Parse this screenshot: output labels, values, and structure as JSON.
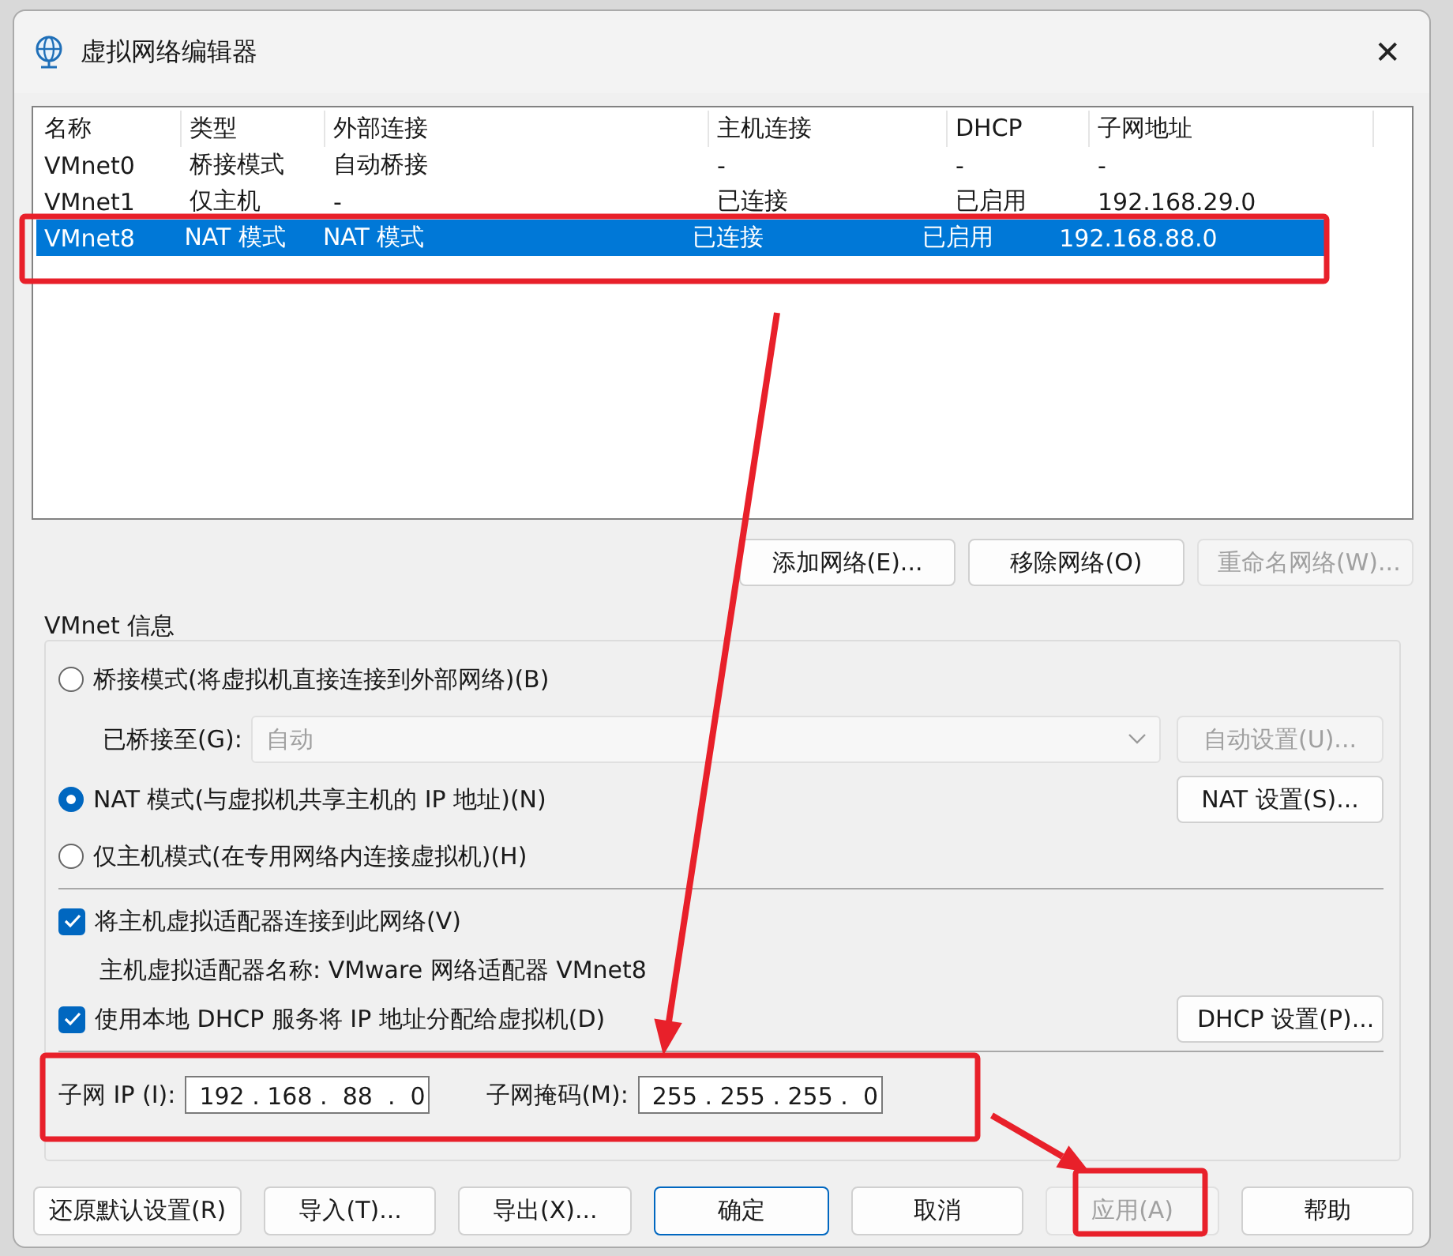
{
  "window": {
    "title": "虚拟网络编辑器",
    "close": "✕"
  },
  "table": {
    "columns": [
      "名称",
      "类型",
      "外部连接",
      "主机连接",
      "DHCP",
      "子网地址"
    ],
    "rows": [
      {
        "cells": [
          "VMnet0",
          "桥接模式",
          "自动桥接",
          "-",
          "-",
          "-"
        ],
        "selected": false
      },
      {
        "cells": [
          "VMnet1",
          "仅主机",
          "-",
          "已连接",
          "已启用",
          "192.168.29.0"
        ],
        "selected": false
      },
      {
        "cells": [
          "VMnet8",
          "NAT 模式",
          "NAT 模式",
          "已连接",
          "已启用",
          "192.168.88.0"
        ],
        "selected": true
      }
    ]
  },
  "list_buttons": [
    {
      "label": "添加网络(E)...",
      "disabled": false
    },
    {
      "label": "移除网络(O)",
      "disabled": false
    },
    {
      "label": "重命名网络(W)...",
      "disabled": true
    }
  ],
  "vmnet_info": {
    "title": "VMnet 信息",
    "bridged": {
      "label": "桥接模式(将虚拟机直接连接到外部网络)(B)",
      "selected": false
    },
    "bridged_to": {
      "label": "已桥接至(G):",
      "value": "自动",
      "disabled": true,
      "button": {
        "label": "自动设置(U)...",
        "disabled": true
      }
    },
    "nat": {
      "label": "NAT 模式(与虚拟机共享主机的 IP 地址)(N)",
      "selected": true,
      "button": {
        "label": "NAT 设置(S)...",
        "disabled": false
      }
    },
    "host_only": {
      "label": "仅主机模式(在专用网络内连接虚拟机)(H)",
      "selected": false
    },
    "connect_adapter": {
      "label": "将主机虚拟适配器连接到此网络(V)",
      "checked": true
    },
    "adapter_name": "主机虚拟适配器名称: VMware 网络适配器 VMnet8",
    "dhcp": {
      "label": "使用本地 DHCP 服务将 IP 地址分配给虚拟机(D)",
      "checked": true,
      "button": {
        "label": "DHCP 设置(P)...",
        "disabled": false
      }
    },
    "subnet_ip": {
      "label": "子网 IP (I):",
      "value": "192 . 168 .  88  .  0"
    },
    "subnet_mask": {
      "label": "子网掩码(M):",
      "value": "255 . 255 . 255 .  0"
    }
  },
  "footer_buttons": [
    {
      "label": "还原默认设置(R)",
      "kind": "normal",
      "disabled": false
    },
    {
      "label": "导入(T)...",
      "kind": "normal",
      "disabled": false
    },
    {
      "label": "导出(X)...",
      "kind": "normal",
      "disabled": false
    },
    {
      "label": "确定",
      "kind": "default",
      "disabled": false
    },
    {
      "label": "取消",
      "kind": "normal",
      "disabled": false
    },
    {
      "label": "应用(A)",
      "kind": "normal",
      "disabled": true
    },
    {
      "label": "帮助",
      "kind": "normal",
      "disabled": false
    }
  ]
}
